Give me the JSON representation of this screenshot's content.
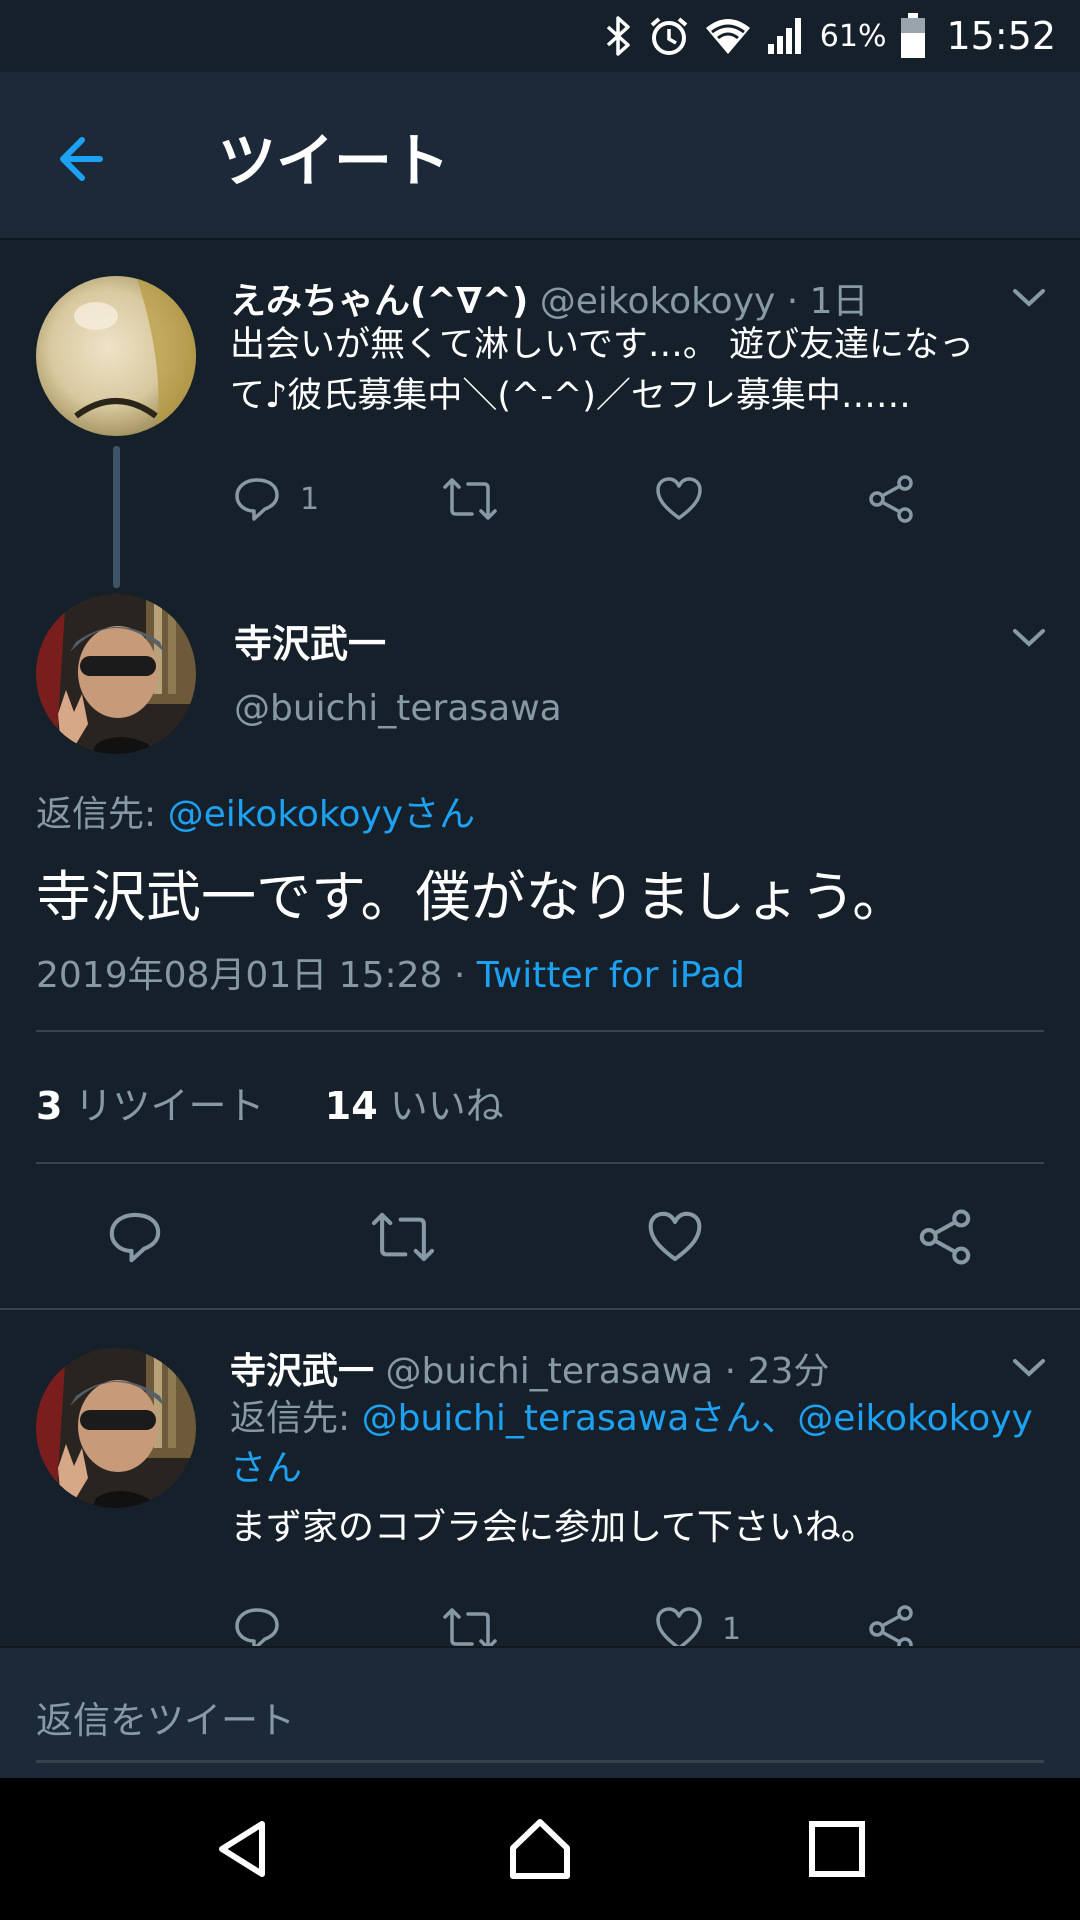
{
  "status_bar": {
    "battery_percent": "61%",
    "time": "15:52",
    "icons": [
      "bluetooth-icon",
      "alarm-icon",
      "wifi-icon",
      "signal-icon",
      "battery-icon"
    ]
  },
  "header": {
    "title": "ツイート",
    "back_icon": "arrow-left-icon"
  },
  "parent_tweet": {
    "display_name": "えみちゃん(^∇^)",
    "handle": "@eikokokoyy",
    "time": "· 1日",
    "text_line1": "出会いが無くて淋しいです…。 遊び友達になっ",
    "text_line2": "て♪彼氏募集中＼(^-^)／セフレ募集中……",
    "reply_count": "1"
  },
  "main_tweet": {
    "display_name": "寺沢武一",
    "handle": "@buichi_terasawa",
    "reply_to_label": "返信先: ",
    "reply_to_link": "@eikokokoyyさん",
    "text": "寺沢武一です。僕がなりましょう。",
    "timestamp": "2019年08月01日 15:28 · ",
    "source": "Twitter for iPad",
    "retweet_count": "3",
    "retweet_label": "リツイート",
    "like_count": "14",
    "like_label": "いいね"
  },
  "reply_tweet": {
    "display_name": "寺沢武一",
    "handle": "@buichi_terasawa",
    "time": "· 23分",
    "reply_to_label": "返信先: ",
    "reply_to_link_line1": "@buichi_terasawaさん、@eikokokoyy",
    "reply_to_link_line2": "さん",
    "text": "まず家のコブラ会に参加して下さいね。",
    "like_count": "1"
  },
  "reply_bar": {
    "placeholder": "返信をツイート"
  },
  "colors": {
    "background": "#15202b",
    "header": "#1c2938",
    "accent": "#1da1f2",
    "muted": "#8899a6",
    "divider": "#38444d"
  }
}
